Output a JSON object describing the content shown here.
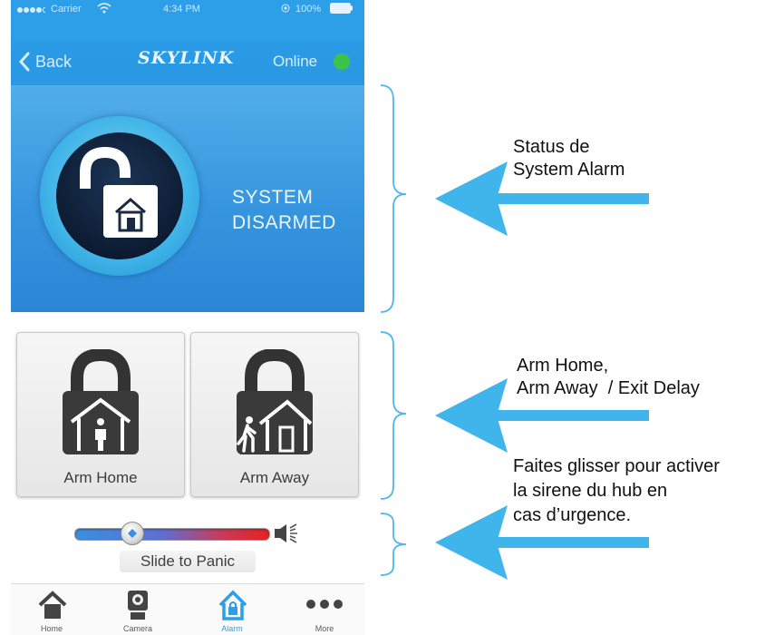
{
  "status_bar": {
    "carrier": "Carrier",
    "time": "4:34 PM",
    "battery": "100%"
  },
  "nav": {
    "back_label": "Back",
    "logo": "SKYLINK",
    "connection_status": "Online",
    "status_color": "#3cc44a"
  },
  "alarm_status": {
    "line1": "SYSTEM",
    "line2": "DISARMED"
  },
  "arm_buttons": {
    "home_label": "Arm Home",
    "away_label": "Arm Away"
  },
  "panic": {
    "caption": "Slide to Panic"
  },
  "tabs": [
    {
      "label": "Home",
      "icon": "house-icon"
    },
    {
      "label": "Camera",
      "icon": "camera-icon"
    },
    {
      "label": "Alarm",
      "icon": "alarm-lock-icon",
      "active": true
    },
    {
      "label": "More",
      "icon": "more-dots-icon"
    }
  ],
  "annotations": {
    "status_line1": "Status de",
    "status_line2": "System Alarm",
    "arm_line1": "Arm Home,",
    "arm_line2": "Arm Away  / Exit Delay",
    "panic_line1": "Faites glisser pour activer",
    "panic_line2": "la sirene du hub en",
    "panic_line3": "cas d’urgence."
  },
  "colors": {
    "accent": "#2d9ee8",
    "arrow": "#3fb5ec"
  }
}
